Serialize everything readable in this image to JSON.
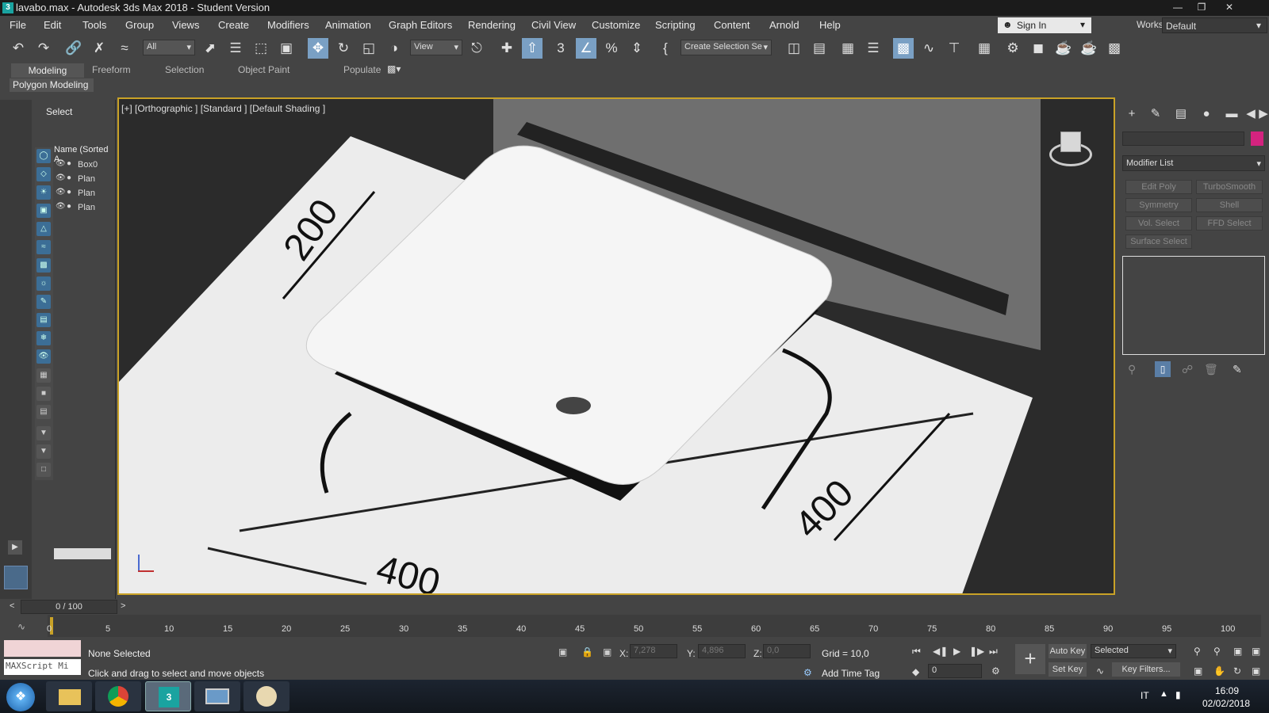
{
  "titlebar": {
    "title": "lavabo.max - Autodesk 3ds Max 2018 - Student Version",
    "minimize": "—",
    "restore": "❐",
    "close": "✕"
  },
  "menu": [
    "File",
    "Edit",
    "Tools",
    "Group",
    "Views",
    "Create",
    "Modifiers",
    "Animation",
    "Graph Editors",
    "Rendering",
    "Civil View",
    "Customize",
    "Scripting",
    "Content",
    "Arnold",
    "Help"
  ],
  "signin": {
    "label": "Sign In"
  },
  "workspaces": {
    "label": "Workspaces:",
    "value": "Default"
  },
  "toolbar": {
    "filter_value": "All",
    "refcoord_value": "View",
    "selection_set_value": "Create Selection Se"
  },
  "ribbon": {
    "tabs": [
      "Modeling",
      "Freeform",
      "Selection",
      "Object Paint",
      "Populate"
    ],
    "panel": "Polygon Modeling"
  },
  "explorer": {
    "title": "Select",
    "column_header": "Name (Sorted A",
    "items": [
      "Box0",
      "Plan",
      "Plan",
      "Plan"
    ]
  },
  "viewport": {
    "label": "[+] [Orthographic ] [Standard ] [Default Shading ]",
    "dim_200": "200",
    "dim_400a": "400",
    "dim_400b": "400"
  },
  "command_panel": {
    "modifier_list": "Modifier List",
    "modifiers": [
      "Edit Poly",
      "TurboSmooth",
      "Symmetry",
      "Shell",
      "Vol. Select",
      "FFD Select",
      "Surface Select"
    ],
    "color": "#d4237f"
  },
  "timeline": {
    "slider": "0 / 100",
    "ticks": [
      "0",
      "5",
      "10",
      "15",
      "20",
      "25",
      "30",
      "35",
      "40",
      "45",
      "50",
      "55",
      "60",
      "65",
      "70",
      "75",
      "80",
      "85",
      "90",
      "95",
      "100"
    ]
  },
  "status": {
    "selection": "None Selected",
    "prompt": "Click and drag to select and move objects",
    "maxscript": "MAXScript Mi",
    "x_label": "X:",
    "x_value": "7,278",
    "y_label": "Y:",
    "y_value": "4,896",
    "z_label": "Z:",
    "z_value": "0,0",
    "grid": "Grid = 10,0",
    "add_time_tag": "Add Time Tag",
    "auto_key": "Auto Key",
    "set_key": "Set Key",
    "selected": "Selected",
    "frame": "0",
    "key_filters": "Key Filters..."
  },
  "taskbar": {
    "lang": "IT",
    "time": "16:09",
    "date": "02/02/2018"
  }
}
